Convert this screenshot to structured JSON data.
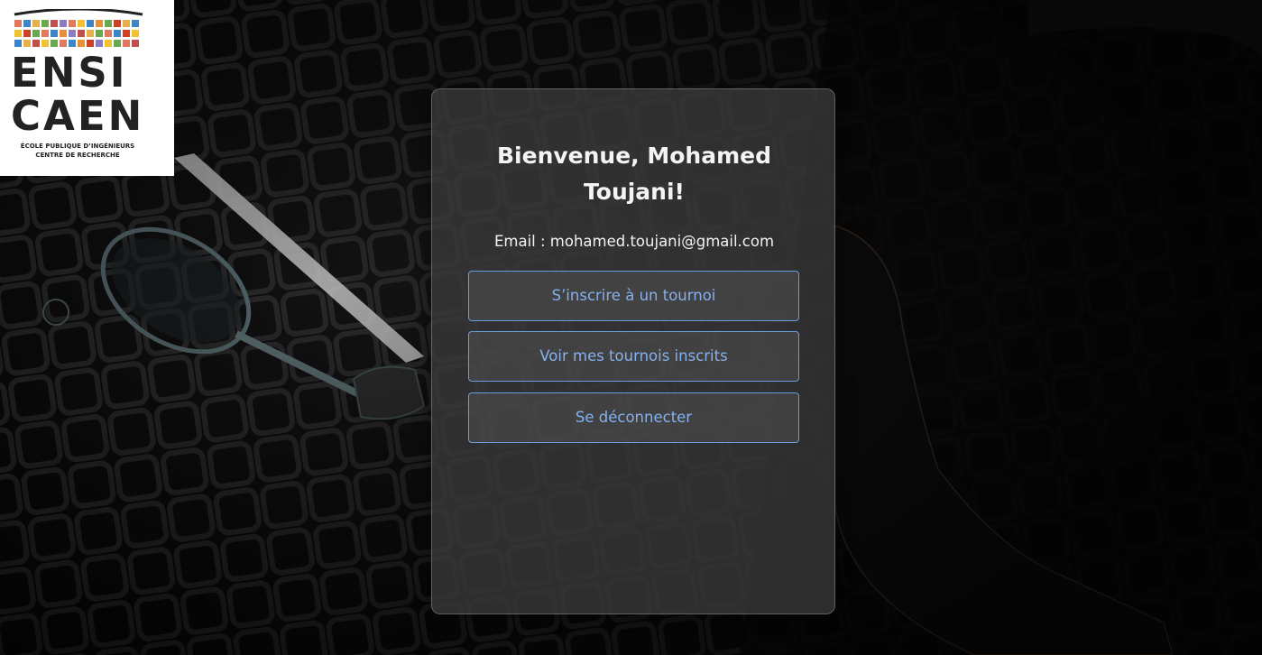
{
  "logo": {
    "line1": "ENSI",
    "line2": "CAEN",
    "tagline1": "ÉCOLE PUBLIQUE D’INGÉNIEURS",
    "tagline2": "CENTRE DE RECHERCHE"
  },
  "welcome": {
    "title": "Bienvenue, Mohamed Toujani!",
    "email": "Email : mohamed.toujani@gmail.com"
  },
  "actions": {
    "register_label": "S’inscrire à un tournoi",
    "my_tournaments_label": "Voir mes tournois inscrits",
    "logout_label": "Se déconnecter"
  },
  "colors": {
    "accent": "#6a9ce0",
    "button_text": "#86b0ef",
    "card_bg": "#3a3a3a",
    "background": "#0b0b0b"
  }
}
